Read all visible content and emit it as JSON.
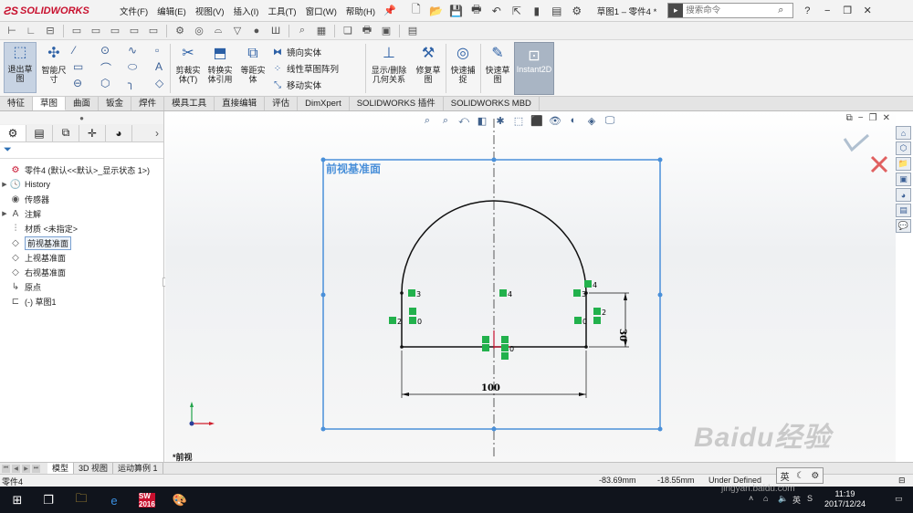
{
  "app": {
    "brand": "SOLIDWORKS",
    "doc_title": "草图1 – 零件4 *",
    "menus": [
      "文件(F)",
      "编辑(E)",
      "视图(V)",
      "插入(I)",
      "工具(T)",
      "窗口(W)",
      "帮助(H)"
    ],
    "search_placeholder": "搜索命令",
    "help_label": "?"
  },
  "ribbon": {
    "exit_sketch": "退出草图",
    "smart_dimension": "智能尺寸",
    "trim": "剪裁实体(T)",
    "convert": "转换实体引用",
    "offset": "等距实体",
    "mirror": "镜向实体",
    "linear_pattern": "线性草图阵列",
    "move": "移动实体",
    "display_delete": "显示/删除几何关系",
    "repair": "修复草图",
    "quick_snap": "快速捕捉",
    "rapid_sketch": "快速草图",
    "instant2d": "Instant2D"
  },
  "tabs": [
    "特征",
    "草图",
    "曲面",
    "钣金",
    "焊件",
    "模具工具",
    "直接编辑",
    "评估",
    "DimXpert",
    "SOLIDWORKS 插件",
    "SOLIDWORKS MBD"
  ],
  "tree": {
    "root": "零件4 (默认<<默认>_显示状态 1>)",
    "items": [
      "History",
      "传感器",
      "注解",
      "材质 <未指定>",
      "前视基准面",
      "上视基准面",
      "右视基准面",
      "原点",
      "(-) 草图1"
    ]
  },
  "canvas": {
    "plane_label": "前视基准面",
    "view_label": "*前视",
    "dim_width": "100",
    "dim_height": "30",
    "relation_labels": [
      "3",
      "4",
      "3",
      "4",
      "2",
      "0",
      "2",
      "0",
      "0"
    ]
  },
  "bottom_tabs": [
    "模型",
    "3D 视图",
    "运动算例 1"
  ],
  "status": {
    "part": "零件4",
    "x": "-83.69mm",
    "y": "-18.55mm",
    "state": "Under Defined",
    "ime": "英"
  },
  "taskbar": {
    "sw_icon": "SW 2016",
    "time": "11:19",
    "date": "2017/12/24",
    "lang": "英"
  },
  "watermark": "Baidu经验",
  "watermark_url": "jingyan.baidu.com"
}
